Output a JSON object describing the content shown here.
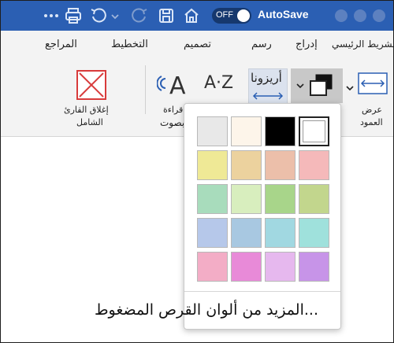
{
  "titlebar": {
    "app_name": "AutoSave",
    "toggle_label": "OFF",
    "bg_color": "#2b5fb3"
  },
  "tabs": [
    {
      "label": "المراجع"
    },
    {
      "label": "التخطيط"
    },
    {
      "label": "تصميم"
    },
    {
      "label": "رسم"
    },
    {
      "label": "إدراج"
    },
    {
      "label": "الشريط الرئيسي"
    }
  ],
  "ribbon": {
    "close_reader_label_line1": "إغلاق القارئ",
    "close_reader_label_line2": "الشامل",
    "read_aloud_line1": "قراءة",
    "read_aloud_line2": "بصوت",
    "text_spacing_glyph": "A·Z",
    "text_direction_label": "أريزونا",
    "column_width_line1": "عرض",
    "column_width_line2": "العمود"
  },
  "page_color_popup": {
    "swatch_rows": [
      [
        "#ffffff",
        "#000000",
        "#fdf5ea",
        "#e8e8e8"
      ],
      [
        "#f5b9ba",
        "#ecbfaa",
        "#ecd29e",
        "#efe996"
      ],
      [
        "#c2d68d",
        "#a8d58a",
        "#d8eebe",
        "#a8dcbc"
      ],
      [
        "#9fe1dc",
        "#a1d8e1",
        "#a8c8e1",
        "#b6c8ea"
      ],
      [
        "#c794e8",
        "#e6b8ee",
        "#e88ad8",
        "#f3adc6"
      ]
    ],
    "selected_color": "#ffffff",
    "more_colors_label": "المزيد من ألوان القرص المضغوط..."
  }
}
